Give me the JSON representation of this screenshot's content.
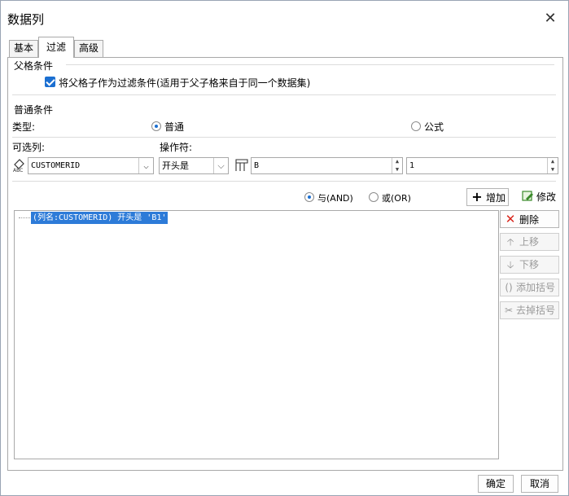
{
  "window": {
    "title": "数据列",
    "close_glyph": "✕"
  },
  "tabs": [
    {
      "label": "基本"
    },
    {
      "label": "过滤"
    },
    {
      "label": "高级"
    }
  ],
  "parent_condition": {
    "heading": "父格条件",
    "checkbox_label": "将父格子作为过滤条件(适用于父子格来自于同一个数据集)",
    "checked": true
  },
  "normal_condition": {
    "heading": "普通条件",
    "type_label": "类型:",
    "type_options": [
      {
        "label": "普通",
        "selected": true
      },
      {
        "label": "公式",
        "selected": false
      }
    ],
    "column_label": "可选列:",
    "operator_label": "操作符:",
    "column_value": "CUSTOMERID",
    "operator_value": "开头是",
    "value_field": "B",
    "count_field": "1"
  },
  "logic": {
    "and_label": "与(AND)",
    "or_label": "或(OR)",
    "and_selected": true,
    "add_label": "增加",
    "modify_label": "修改"
  },
  "conditions": [
    {
      "text": "(列名:CUSTOMERID) 开头是 'B1'",
      "selected": true
    }
  ],
  "side_buttons": {
    "delete": "删除",
    "move_up": "上移",
    "move_down": "下移",
    "add_bracket": "添加括号",
    "remove_bracket": "去掉括号"
  },
  "footer": {
    "ok": "确定",
    "cancel": "取消"
  },
  "colors": {
    "accent": "#1b6fd1",
    "selection": "#2d7bd8",
    "delete_red": "#d9261c"
  }
}
